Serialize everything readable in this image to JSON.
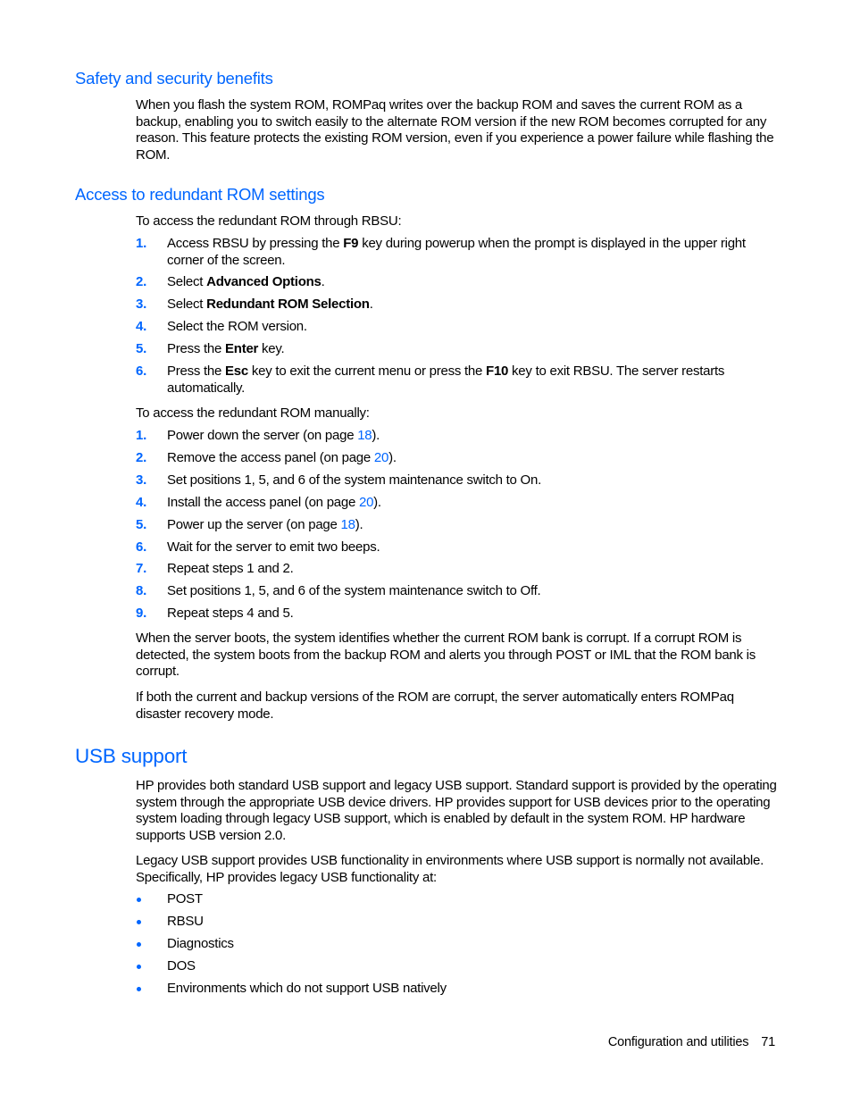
{
  "sections": {
    "safety": {
      "heading": "Safety and security benefits",
      "paragraph": "When you flash the system ROM, ROMPaq writes over the backup ROM and saves the current ROM as a backup, enabling you to switch easily to the alternate ROM version if the new ROM becomes corrupted for any reason. This feature protects the existing ROM version, even if you experience a power failure while flashing the ROM."
    },
    "access": {
      "heading": "Access to redundant ROM settings",
      "rbsu_intro": "To access the redundant ROM through RBSU:",
      "rbsu_steps": [
        {
          "num": "1.",
          "pre": "Access RBSU by pressing the ",
          "bold": "F9",
          "post": " key during powerup when the prompt is displayed in the upper right corner of the screen."
        },
        {
          "num": "2.",
          "pre": "Select ",
          "bold": "Advanced Options",
          "post": "."
        },
        {
          "num": "3.",
          "pre": "Select ",
          "bold": "Redundant ROM Selection",
          "post": "."
        },
        {
          "num": "4.",
          "pre": "Select the ROM version.",
          "bold": "",
          "post": ""
        },
        {
          "num": "5.",
          "pre": "Press the ",
          "bold": "Enter",
          "post": " key."
        },
        {
          "num": "6.",
          "pre": "Press the ",
          "bold": "Esc",
          "mid": " key to exit the current menu or press the ",
          "bold2": "F10",
          "post": " key to exit RBSU. The server restarts automatically."
        }
      ],
      "manual_intro": "To access the redundant ROM manually:",
      "manual_steps": [
        {
          "num": "1.",
          "pre": "Power down the server (on page ",
          "link": "18",
          "post": ")."
        },
        {
          "num": "2.",
          "pre": "Remove the access panel (on page ",
          "link": "20",
          "post": ")."
        },
        {
          "num": "3.",
          "pre": "Set positions 1, 5, and 6 of the system maintenance switch to On.",
          "link": "",
          "post": ""
        },
        {
          "num": "4.",
          "pre": "Install the access panel (on page ",
          "link": "20",
          "post": ")."
        },
        {
          "num": "5.",
          "pre": "Power up the server (on page ",
          "link": "18",
          "post": ")."
        },
        {
          "num": "6.",
          "pre": "Wait for the server to emit two beeps.",
          "link": "",
          "post": ""
        },
        {
          "num": "7.",
          "pre": "Repeat steps 1 and 2.",
          "link": "",
          "post": ""
        },
        {
          "num": "8.",
          "pre": "Set positions 1, 5, and 6 of the system maintenance switch to Off.",
          "link": "",
          "post": ""
        },
        {
          "num": "9.",
          "pre": "Repeat steps 4 and 5.",
          "link": "",
          "post": ""
        }
      ],
      "boot_paragraph": "When the server boots, the system identifies whether the current ROM bank is corrupt. If a corrupt ROM is detected, the system boots from the backup ROM and alerts you through POST or IML that the ROM bank is corrupt.",
      "disaster_paragraph": "If both the current and backup versions of the ROM are corrupt, the server automatically enters ROMPaq disaster recovery mode."
    },
    "usb": {
      "heading": "USB support",
      "paragraph1": "HP provides both standard USB support and legacy USB support. Standard support is provided by the operating system through the appropriate USB device drivers. HP provides support for USB devices prior to the operating system loading through legacy USB support, which is enabled by default in the system ROM. HP hardware supports USB version 2.0.",
      "paragraph2": "Legacy USB support provides USB functionality in environments where USB support is normally not available. Specifically, HP provides legacy USB functionality at:",
      "bullets": [
        "POST",
        "RBSU",
        "Diagnostics",
        "DOS",
        "Environments which do not support USB natively"
      ]
    }
  },
  "footer": {
    "chapter": "Configuration and utilities",
    "page": "71"
  },
  "colors": {
    "accent": "#0066ff",
    "text": "#000000"
  }
}
